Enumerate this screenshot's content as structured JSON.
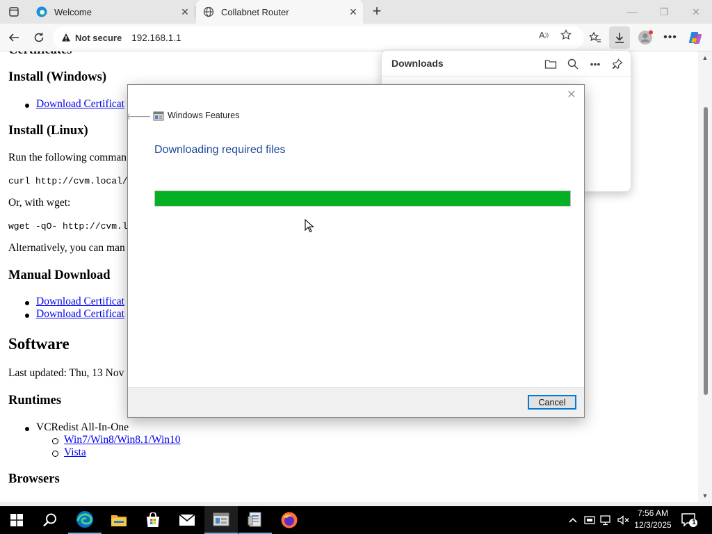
{
  "browser": {
    "tabs": [
      {
        "label": "Welcome",
        "active": false
      },
      {
        "label": "Collabnet Router",
        "active": true
      }
    ],
    "address": {
      "security_label": "Not secure",
      "url": "192.168.1.1"
    }
  },
  "page": {
    "h_install_windows": "Install (Windows)",
    "link_download_cert_1": "Download Certificat",
    "h_install_linux": "Install (Linux)",
    "p_run_following": "Run the following comman",
    "code_curl": "curl http://cvm.local/l",
    "p_or_wget": "Or, with wget:",
    "code_wget": "wget -qO- http://cvm.loc",
    "p_alternatively": "Alternatively, you can man",
    "h_manual_download": "Manual Download",
    "link_download_cert_2": "Download Certificat",
    "link_download_cert_3": "Download Certificat",
    "h_software": "Software",
    "p_last_updated": "Last updated: Thu, 13 Nov",
    "h_runtimes": "Runtimes",
    "li_vcredist": "VCRedist All-In-One",
    "link_win7": "Win7/Win8/Win8.1/Win10",
    "link_vista": "Vista",
    "h_browsers": "Browsers"
  },
  "downloads_panel": {
    "title": "Downloads"
  },
  "dialog": {
    "title": "Windows Features",
    "heading": "Downloading required files",
    "progress": 1.0,
    "cancel_label": "Cancel",
    "progress_color": "#06b025"
  },
  "taskbar": {
    "time": "7:56 AM",
    "date": "12/3/2025",
    "notification_count": "1",
    "apps": [
      "start-icon",
      "search-icon",
      "edge-icon",
      "file-explorer-icon",
      "store-icon",
      "mail-icon",
      "windows-features-icon",
      "control-panel-icon",
      "firefox-icon"
    ]
  }
}
